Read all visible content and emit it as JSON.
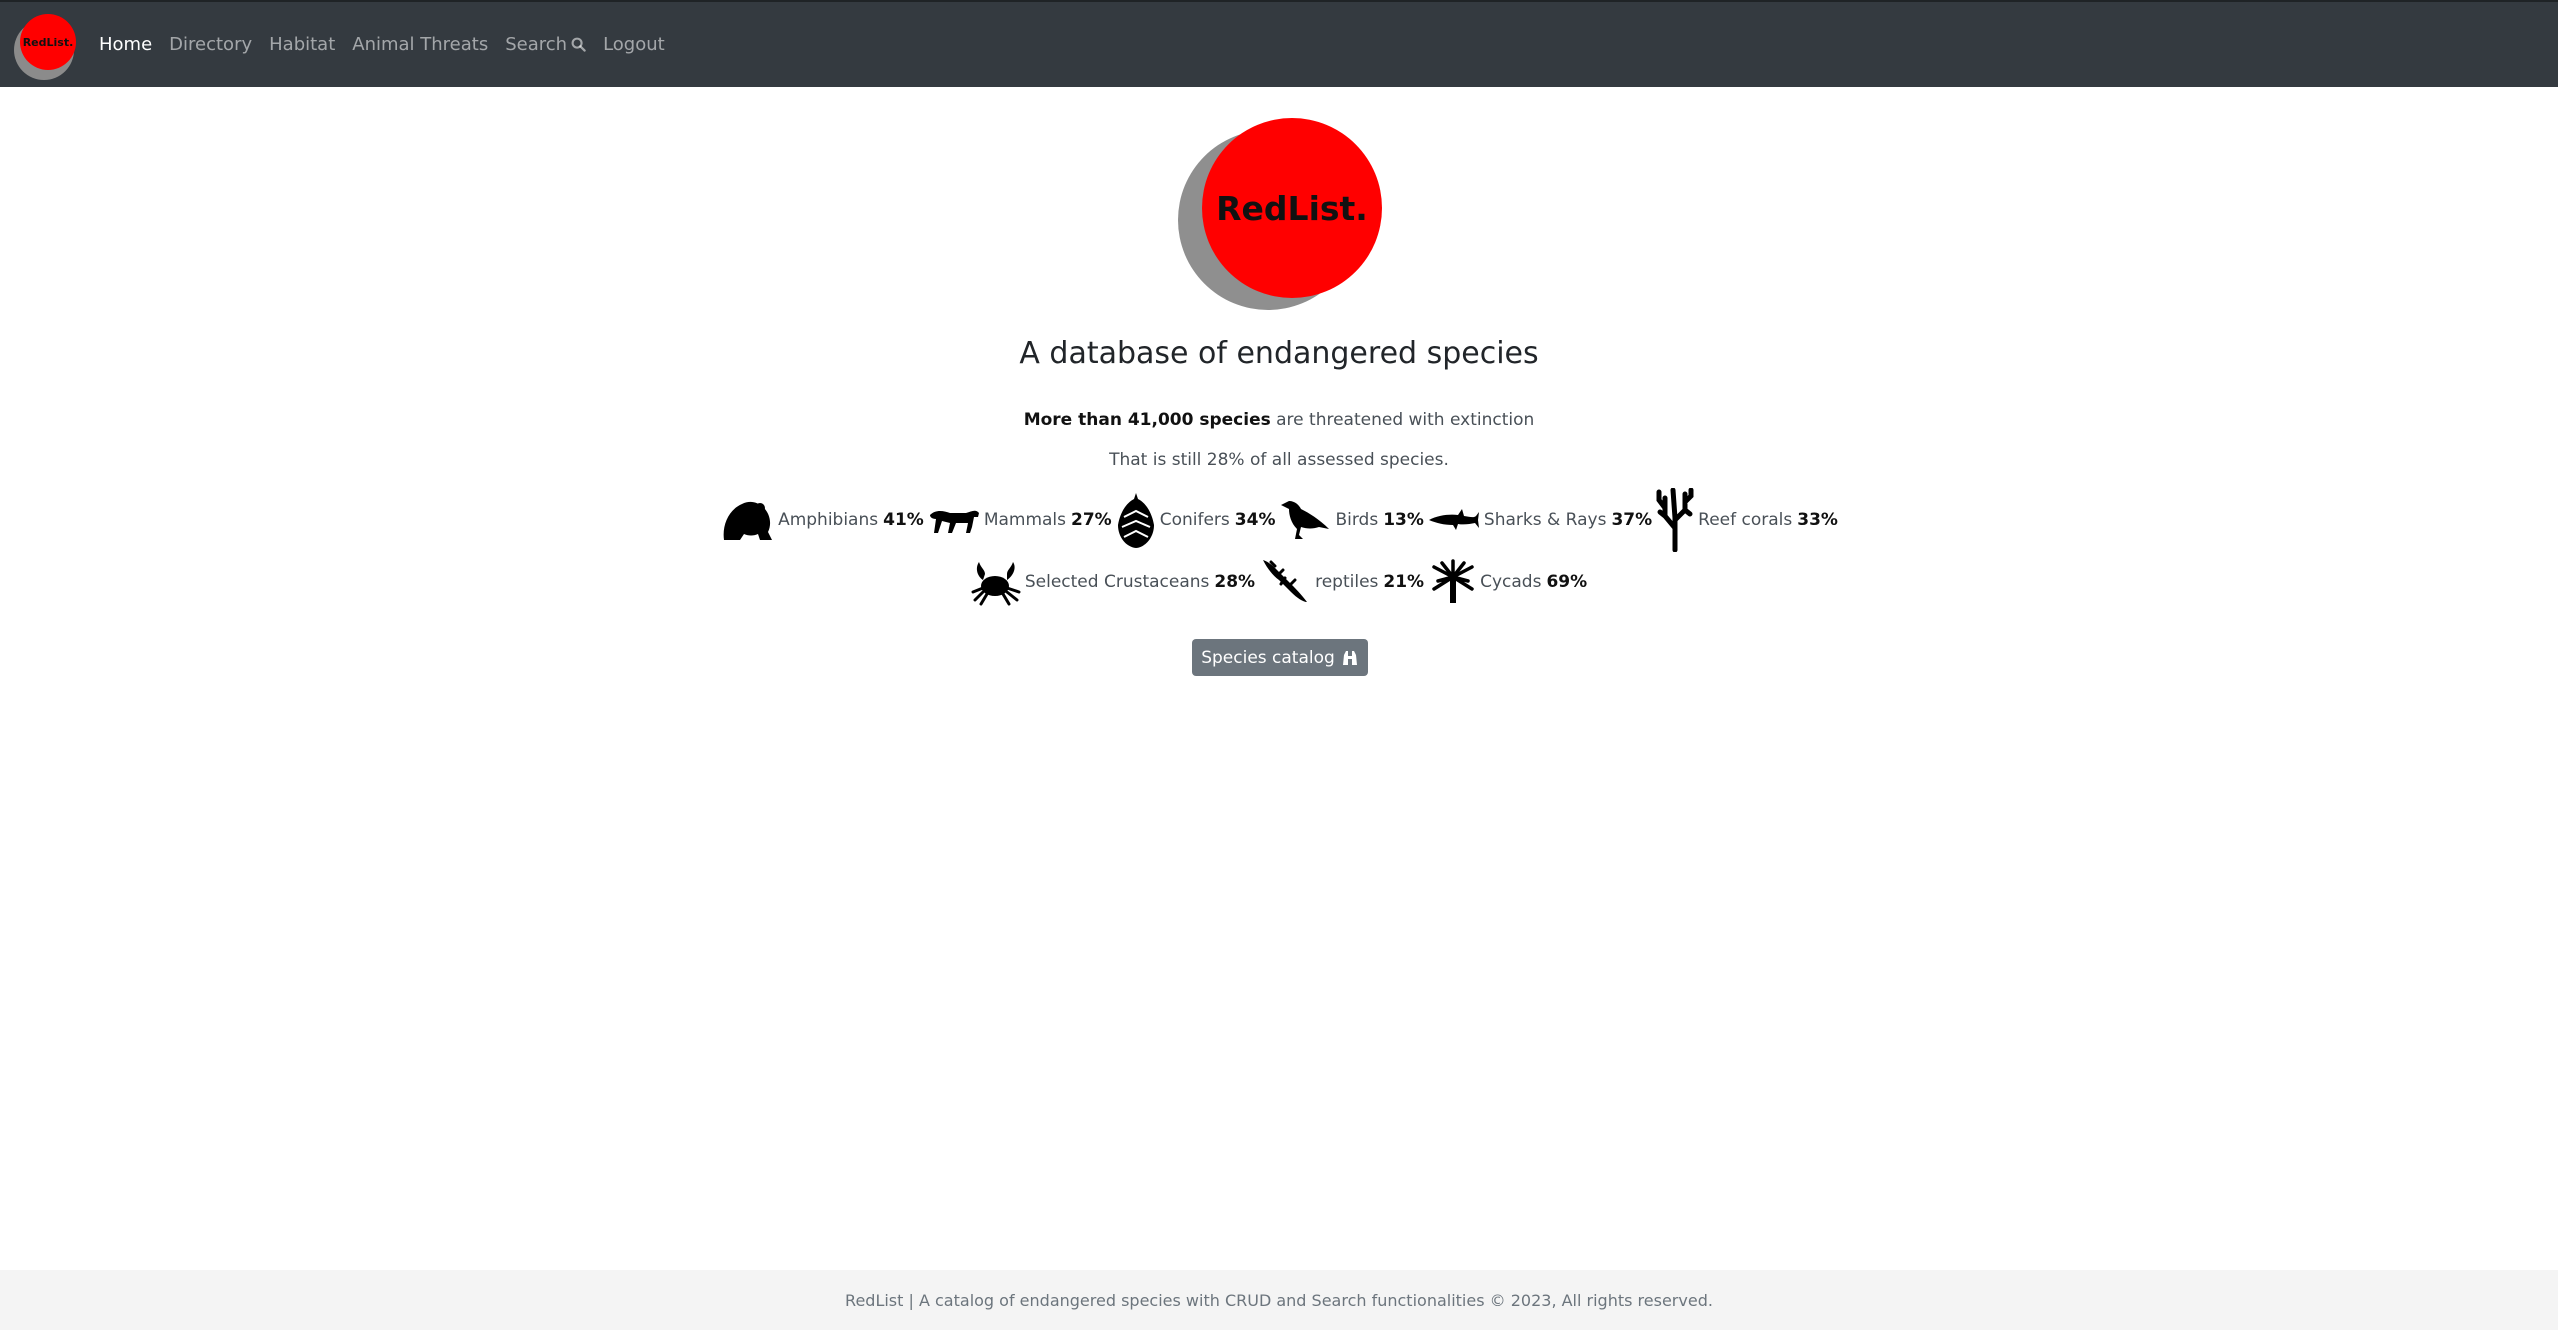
{
  "nav": {
    "logo_text": "RedList.",
    "links": [
      {
        "label": "Home",
        "active": true
      },
      {
        "label": "Directory"
      },
      {
        "label": "Habitat"
      },
      {
        "label": "Animal Threats"
      },
      {
        "label": "Search",
        "icon": "search-icon"
      },
      {
        "label": "Logout"
      }
    ]
  },
  "hero": {
    "logo_text": "RedList.",
    "headline": "A database of endangered species",
    "stat_bold": "More than 41,000 species",
    "stat_rest": " are threatened with extinction",
    "stat_line2": "That is still 28% of all assessed species."
  },
  "species": [
    {
      "icon": "frog-icon",
      "name": "Amphibians",
      "pct": "41%"
    },
    {
      "icon": "panther-icon",
      "name": "Mammals",
      "pct": "27%"
    },
    {
      "icon": "pinecone-icon",
      "name": "Conifers",
      "pct": "34%"
    },
    {
      "icon": "crow-icon",
      "name": "Birds",
      "pct": "13%"
    },
    {
      "icon": "shark-icon",
      "name": "Sharks & Rays",
      "pct": "37%"
    },
    {
      "icon": "coral-icon",
      "name": "Reef corals",
      "pct": "33%"
    },
    {
      "icon": "crab-icon",
      "name": "Selected Crustaceans",
      "pct": "28%"
    },
    {
      "icon": "lizard-icon",
      "name": "reptiles",
      "pct": "21%"
    },
    {
      "icon": "palm-icon",
      "name": "Cycads",
      "pct": "69%"
    }
  ],
  "catalog_button": {
    "label": "Species catalog",
    "icon": "binoculars-icon"
  },
  "footer": {
    "text": "RedList | A catalog of endangered species with CRUD and Search functionalities © 2023, All rights reserved."
  },
  "colors": {
    "navbar": "#343a40",
    "brand_red": "#ff0000",
    "button": "#6c757d",
    "footer_bg": "#f4f4f4"
  }
}
